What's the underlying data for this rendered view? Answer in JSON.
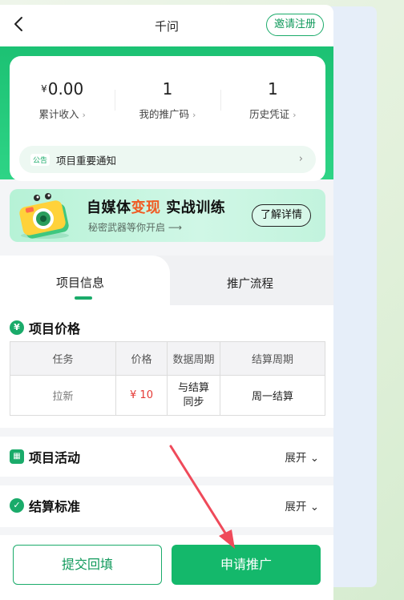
{
  "header": {
    "title": "千问",
    "invite_label": "邀请注册"
  },
  "stats": [
    {
      "currency": "¥",
      "value": "0.00",
      "label": "累计收入"
    },
    {
      "currency": "",
      "value": "1",
      "label": "我的推广码"
    },
    {
      "currency": "",
      "value": "1",
      "label": "历史凭证"
    }
  ],
  "notice": {
    "badge": "公告",
    "text": "项目重要通知"
  },
  "banner": {
    "title_part1": "自媒体",
    "title_highlight": "变现",
    "title_part2": " 实战训练",
    "subtitle": "秘密武器等你开启 ⟶",
    "button_label": "了解详情"
  },
  "tabs": [
    {
      "label": "项目信息",
      "active": true
    },
    {
      "label": "推广流程",
      "active": false
    }
  ],
  "sections": {
    "price": {
      "icon": "¥",
      "title": "项目价格"
    },
    "activity": {
      "icon": "▦",
      "title": "项目活动",
      "expand_label": "展开"
    },
    "settlement": {
      "icon": "✓",
      "title": "结算标准",
      "expand_label": "展开"
    }
  },
  "price_table": {
    "headers": [
      "任务",
      "价格",
      "数据周期",
      "结算周期"
    ],
    "row": {
      "task": "拉新",
      "price": "¥ 10",
      "data_cycle": "与结算\n同步",
      "settle_cycle": "周一结算"
    }
  },
  "bottom": {
    "secondary_label": "提交回填",
    "primary_label": "申请推广"
  },
  "colors": {
    "accent": "#1aab6a",
    "price_red": "#e53935",
    "highlight_orange": "#f15a22",
    "annotation_arrow": "#ef4a5a"
  }
}
